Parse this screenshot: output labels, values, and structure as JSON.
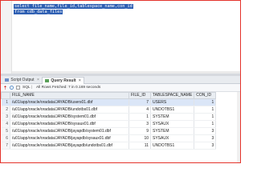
{
  "editor": {
    "lines": [
      "select file_name,file_id,tablespace_name,con_id",
      "from cdb_data_files"
    ]
  },
  "tabs": [
    {
      "label": "Script Output",
      "active": false
    },
    {
      "label": "Query Result",
      "active": true
    }
  ],
  "toolbar": {
    "sql_label": "SQL",
    "status": "All Rows Fetched: 7 in 0.169 seconds"
  },
  "table": {
    "headers": [
      "FILE_NAME",
      "FILE_ID",
      "TABLESPACE_NAME",
      "CON_ID"
    ],
    "rows": [
      {
        "rn": "1",
        "file_name": "/u01/app/oracle/oradata/JAYADB/users01.dbf",
        "file_id": "7",
        "tablespace": "USERS",
        "con_id": "1"
      },
      {
        "rn": "2",
        "file_name": "/u01/app/oracle/oradata/JAYADB/undotbs01.dbf",
        "file_id": "4",
        "tablespace": "UNDOTBS1",
        "con_id": "1"
      },
      {
        "rn": "3",
        "file_name": "/u01/app/oracle/oradata/JAYADB/system01.dbf",
        "file_id": "1",
        "tablespace": "SYSTEM",
        "con_id": "1"
      },
      {
        "rn": "4",
        "file_name": "/u01/app/oracle/oradata/JAYADB/sysaux01.dbf",
        "file_id": "3",
        "tablespace": "SYSAUX",
        "con_id": "1"
      },
      {
        "rn": "5",
        "file_name": "/u01/app/oracle/oradata/JAYADB/jayapdb/system01.dbf",
        "file_id": "9",
        "tablespace": "SYSTEM",
        "con_id": "3"
      },
      {
        "rn": "6",
        "file_name": "/u01/app/oracle/oradata/JAYADB/jayapdb/sysaux01.dbf",
        "file_id": "10",
        "tablespace": "SYSAUX",
        "con_id": "3"
      },
      {
        "rn": "7",
        "file_name": "/u01/app/oracle/oradata/JAYADB/jayapdb/undotbs01.dbf",
        "file_id": "11",
        "tablespace": "UNDOTBS1",
        "con_id": "3"
      }
    ]
  },
  "colors": {
    "frame_border": "#e4332b",
    "selection": "#2e5fb3"
  }
}
